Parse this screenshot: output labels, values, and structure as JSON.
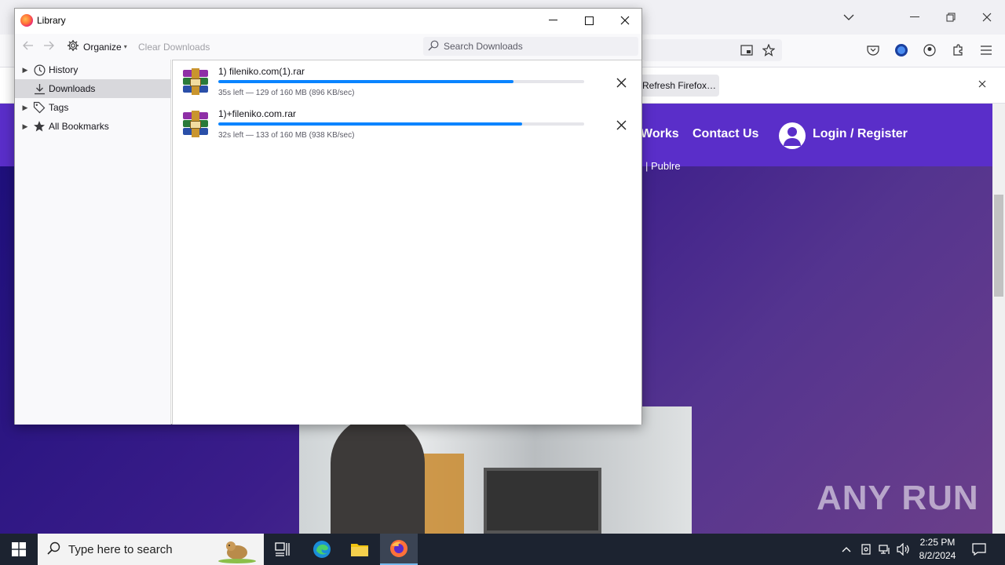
{
  "background_browser": {
    "notification_button": "Refresh Firefox…",
    "nav_links": [
      "Works",
      "Contact Us"
    ],
    "login_label": "Login / Register",
    "subtext": "| Publre"
  },
  "library": {
    "title": "Library",
    "toolbar": {
      "organize_label": "Organize",
      "clear_downloads_label": "Clear Downloads",
      "search_placeholder": "Search Downloads"
    },
    "sidebar": {
      "items": [
        {
          "label": "History",
          "icon": "clock-icon",
          "expandable": true,
          "selected": false
        },
        {
          "label": "Downloads",
          "icon": "download-icon",
          "expandable": false,
          "selected": true
        },
        {
          "label": "Tags",
          "icon": "tag-icon",
          "expandable": true,
          "selected": false
        },
        {
          "label": "All Bookmarks",
          "icon": "star-icon",
          "expandable": true,
          "selected": false
        }
      ]
    },
    "downloads": [
      {
        "name": "1) fileniko.com(1).rar",
        "progress": 0.806,
        "status": "35s left — 129 of 160 MB (896 KB/sec)"
      },
      {
        "name": "1)+fileniko.com.rar",
        "progress": 0.831,
        "status": "32s left — 133 of 160 MB (938 KB/sec)"
      }
    ]
  },
  "taskbar": {
    "search_placeholder": "Type here to search",
    "time": "2:25 PM",
    "date": "8/2/2024"
  },
  "watermark": "ANY RUN",
  "colors": {
    "progress_fill": "#0a84ff",
    "site_nav": "#5a2ec9",
    "taskbar": "#1c2330"
  }
}
